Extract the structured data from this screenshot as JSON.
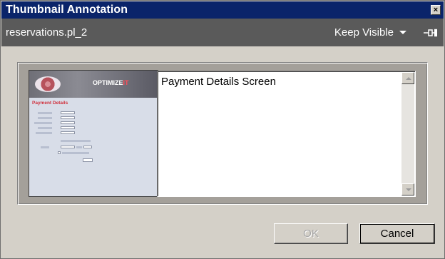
{
  "window": {
    "title": "Thumbnail Annotation",
    "close_glyph": "×"
  },
  "header": {
    "document_name": "reservations.pl_2",
    "keep_visible_label": "Keep Visible",
    "keep_visible_caret_icon": "caret-down-icon",
    "pin_icon": "pin-icon"
  },
  "thumbnail": {
    "brand_main": "OPTIMIZE",
    "brand_accent": "IT",
    "page_heading": "Payment Details"
  },
  "annotation": {
    "text": "Payment Details Screen"
  },
  "scrollbar": {
    "up_icon": "arrow-up-icon",
    "down_icon": "arrow-down-icon"
  },
  "buttons": {
    "ok_label": "OK",
    "cancel_label": "Cancel"
  },
  "colors": {
    "titlebar": "#0a246a",
    "subheader": "#5a5a5a",
    "window_bg": "#d4d0c8",
    "text_white": "#ffffff",
    "accent_red": "#d02f3b"
  }
}
